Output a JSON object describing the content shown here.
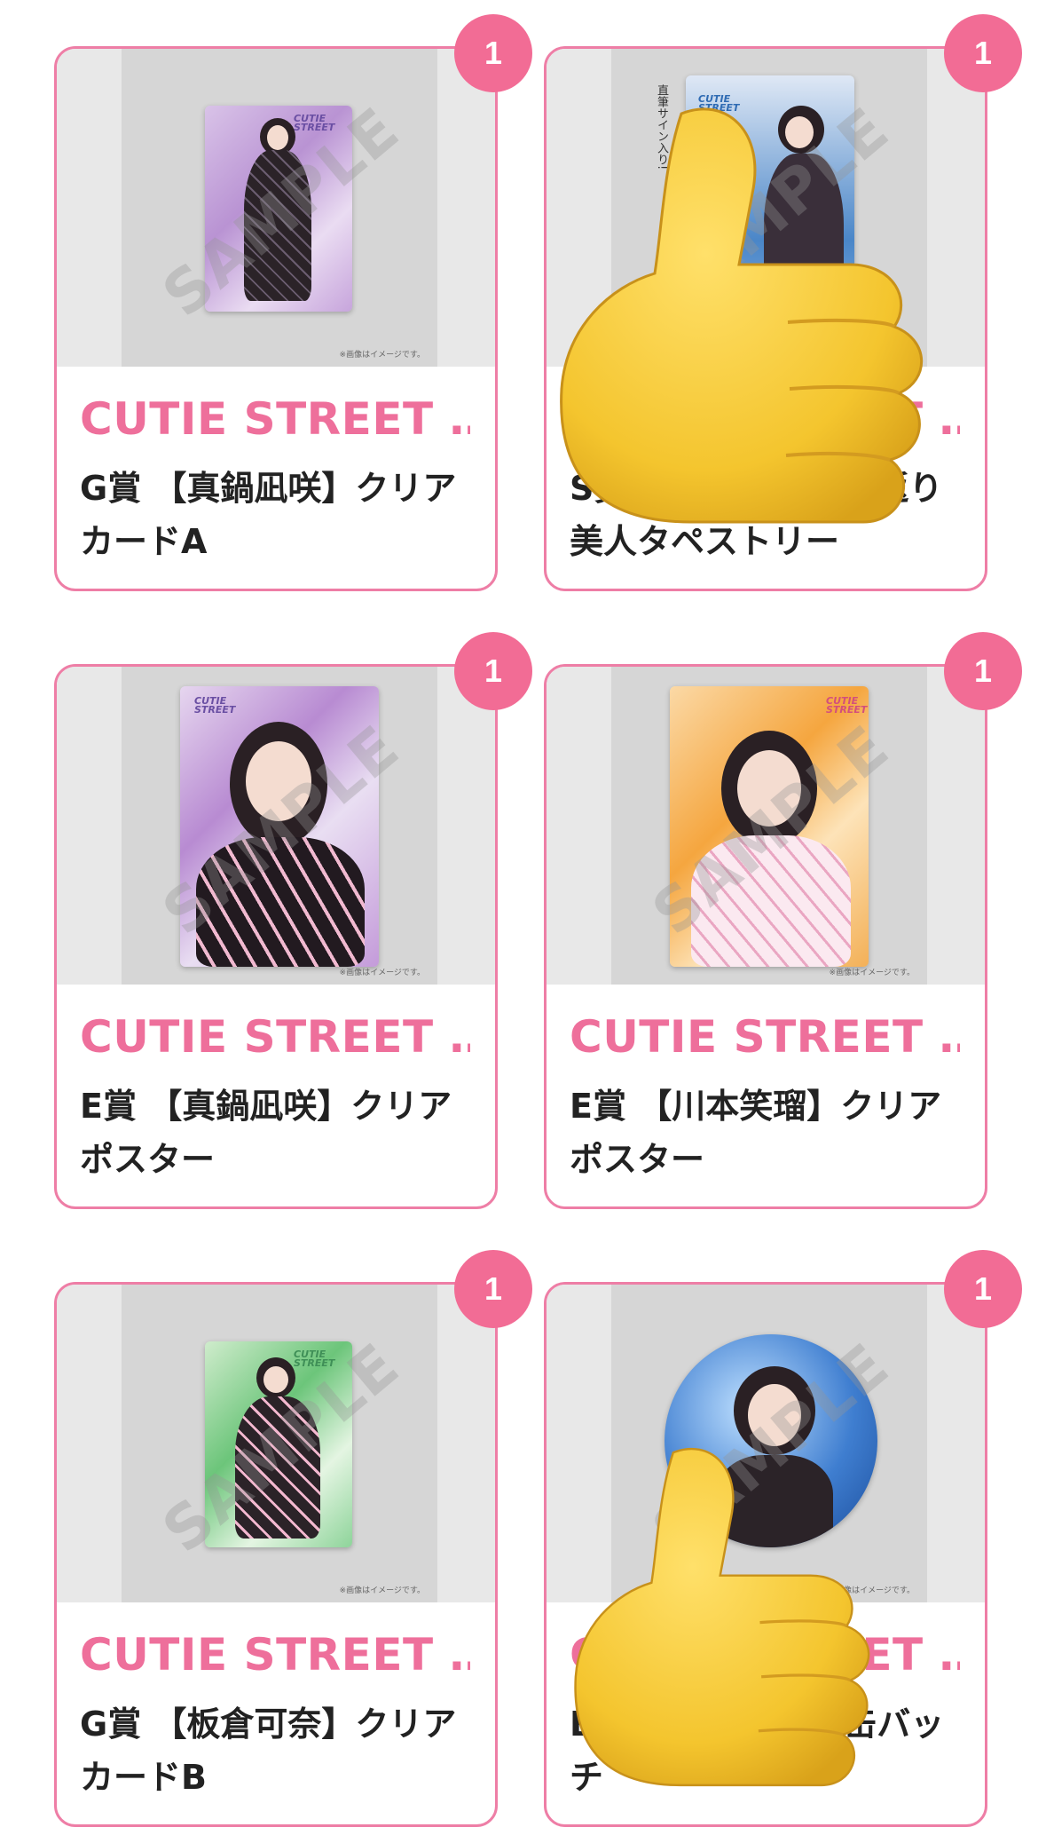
{
  "items": [
    {
      "brand": "CUTIE STREET …",
      "title": "G賞 【真鍋凪咲】クリアカードA",
      "qty": "1",
      "watermark": "SAMPLE",
      "note": "※画像はイメージです。"
    },
    {
      "brand": "CUTIE STREET …",
      "title": "S賞 【増田彩乃】見返り美人タペストリー",
      "qty": "1",
      "watermark": "SAMPLE",
      "note": "※画像はイメージです。",
      "tag": "直筆サイン入り!"
    },
    {
      "brand": "CUTIE STREET …",
      "title": "E賞 【真鍋凪咲】クリアポスター",
      "qty": "1",
      "watermark": "SAMPLE",
      "note": "※画像はイメージです。"
    },
    {
      "brand": "CUTIE STREET …",
      "title": "E賞 【川本笑瑠】クリアポスター",
      "qty": "1",
      "watermark": "SAMPLE",
      "note": "※画像はイメージです。"
    },
    {
      "brand": "CUTIE STREET …",
      "title": "G賞 【板倉可奈】クリアカードB",
      "qty": "1",
      "watermark": "SAMPLE",
      "note": "※画像はイメージです。"
    },
    {
      "brand": "CUTIE STREET …",
      "title": "B賞 【増田彩乃】缶バッチ",
      "qty": "1",
      "watermark": "SAMPLE",
      "note": "※画像はイメージです。"
    }
  ],
  "logo_text": "CUTIE STREET",
  "colors": {
    "accent": "#ee6f9b",
    "border": "#ee7ea6",
    "badge": "#f26c95",
    "thumb": "#f5c938"
  },
  "overlay_icon": "thumbs-up-emoji"
}
